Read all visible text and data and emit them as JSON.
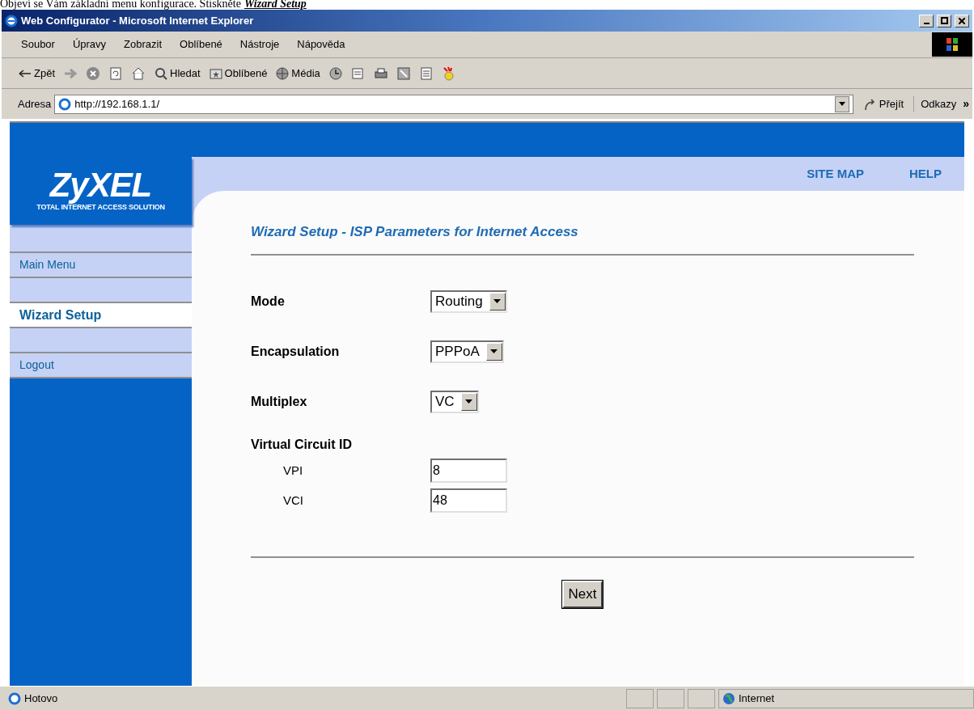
{
  "caption": {
    "text": "Objeví se Vám základní menu konfigurace. Stiskněte",
    "link": "Wizard Setup"
  },
  "window": {
    "title": "Web Configurator - Microsoft Internet Explorer"
  },
  "menu": [
    "Soubor",
    "Úpravy",
    "Zobrazit",
    "Oblíbené",
    "Nástroje",
    "Nápověda"
  ],
  "toolbar": [
    {
      "kind": "back",
      "label": "Zpět"
    },
    {
      "kind": "forward"
    },
    {
      "kind": "stop"
    },
    {
      "kind": "refresh"
    },
    {
      "kind": "home"
    },
    {
      "kind": "search",
      "label": "Hledat"
    },
    {
      "kind": "favorites",
      "label": "Oblíbené"
    },
    {
      "kind": "media",
      "label": "Média"
    },
    {
      "kind": "history"
    },
    {
      "kind": "mail"
    },
    {
      "kind": "print"
    },
    {
      "kind": "edit"
    },
    {
      "kind": "note"
    },
    {
      "kind": "messenger"
    }
  ],
  "address": {
    "label": "Adresa",
    "url": "http://192.168.1.1/",
    "go": "Přejít",
    "links": "Odkazy",
    "more": "»"
  },
  "page": {
    "logo": "ZyXEL",
    "tagline": "TOTAL INTERNET ACCESS SOLUTION",
    "top_links": [
      "SITE MAP",
      "HELP"
    ],
    "sidebar": [
      {
        "label": "Main Menu",
        "selected": false
      },
      {
        "label": "Wizard Setup",
        "selected": true
      },
      {
        "label": "Logout",
        "selected": false
      }
    ],
    "heading": "Wizard Setup - ISP Parameters for Internet Access",
    "fields": [
      {
        "kind": "select",
        "label": "Mode",
        "value": "Routing"
      },
      {
        "kind": "select",
        "label": "Encapsulation",
        "value": "PPPoA"
      },
      {
        "kind": "select",
        "label": "Multiplex",
        "value": "VC"
      },
      {
        "kind": "group",
        "label": "Virtual Circuit ID"
      },
      {
        "kind": "text",
        "label": "VPI",
        "value": "8"
      },
      {
        "kind": "text",
        "label": "VCI",
        "value": "48"
      }
    ],
    "button": "Next"
  },
  "status_bar": {
    "text": "Hotovo",
    "zone": "Internet"
  }
}
